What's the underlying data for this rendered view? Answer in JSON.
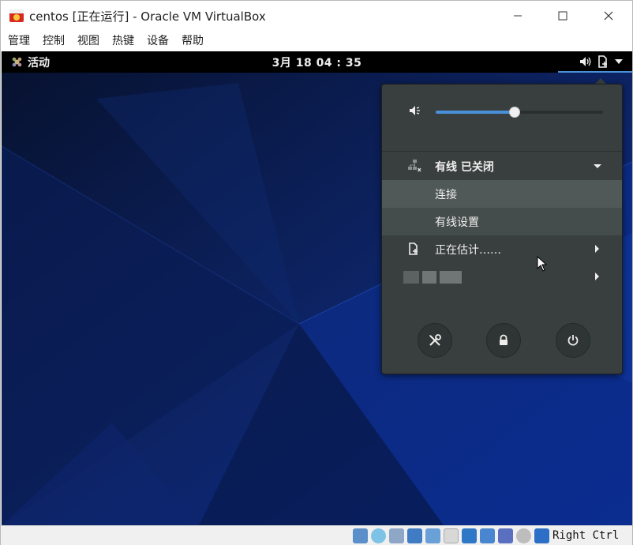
{
  "window": {
    "title": "centos [正在运行] - Oracle VM VirtualBox",
    "controls": [
      "minimize",
      "maximize",
      "close"
    ]
  },
  "menubar": {
    "items": [
      "管理",
      "控制",
      "视图",
      "热键",
      "设备",
      "帮助"
    ]
  },
  "guest": {
    "topbar": {
      "activities_label": "活动",
      "clock": "3月 18  04 : 35",
      "tray_icons": [
        "volume-icon",
        "battery-charging-icon",
        "dropdown-arrow-icon"
      ]
    },
    "system_menu": {
      "volume_level": 0.47,
      "network": {
        "label": "有线 已关闭",
        "items": [
          "连接",
          "有线设置"
        ]
      },
      "battery": {
        "label": "正在估计……"
      },
      "user": {
        "label_redacted": true
      },
      "actions": [
        "settings-icon",
        "lock-icon",
        "power-icon"
      ]
    },
    "colors": {
      "accent": "#4a90d9",
      "popup_bg": "#393f3f",
      "wallpaper_base": "#0b1a4d"
    }
  },
  "statusbar": {
    "host_key": "Right Ctrl"
  }
}
